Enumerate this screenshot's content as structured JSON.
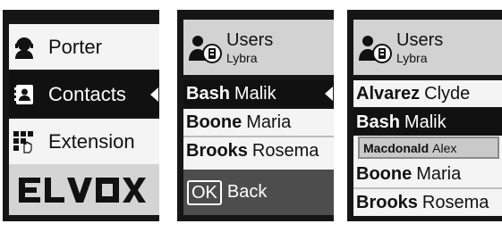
{
  "screen1": {
    "menu": [
      {
        "label": "Porter",
        "icon": "porter-headset-icon"
      },
      {
        "label": "Contacts",
        "icon": "contacts-book-icon",
        "selected": true
      },
      {
        "label": "Extension",
        "icon": "extension-keypad-icon"
      }
    ],
    "logo": "ELVOX"
  },
  "screen2": {
    "header": {
      "title": "Users",
      "subtitle": "Lybra"
    },
    "list": [
      {
        "last": "Bash",
        "first": "Malik",
        "selected": true
      },
      {
        "last": "Boone",
        "first": "Maria"
      },
      {
        "last": "Brooks",
        "first": "Rosema"
      }
    ],
    "ok_label": "OK",
    "back_label": "Back"
  },
  "screen3": {
    "header": {
      "title": "Users",
      "subtitle": "Lybra"
    },
    "list": [
      {
        "last": "Alvarez",
        "first": "Clyde"
      },
      {
        "last": "Bash",
        "first": "Malik",
        "selected": true
      },
      {
        "last": "Boone",
        "first": "Maria"
      },
      {
        "last": "Brooks",
        "first": "Rosema"
      }
    ],
    "popup": {
      "last": "Macdonald",
      "first": "Alex"
    }
  },
  "colors": {
    "bezel": "#161616",
    "selected_row": "#111111",
    "header": "#d2d2d2",
    "footer": "#4d4d4d"
  }
}
